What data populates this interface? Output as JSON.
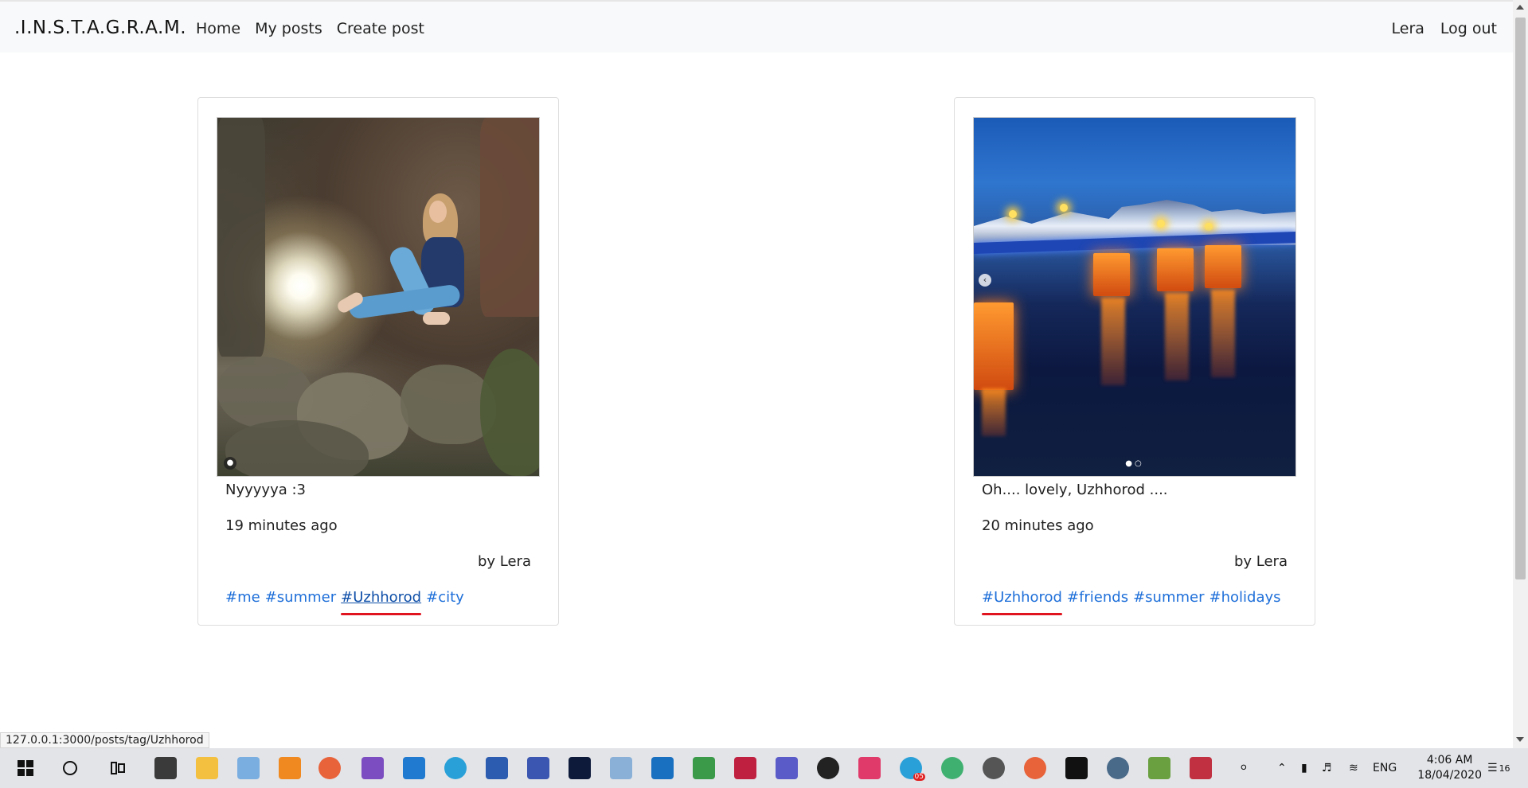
{
  "navbar": {
    "brand": ".I.N.S.T.A.G.R.A.M.",
    "links": [
      "Home",
      "My posts",
      "Create post"
    ],
    "user": "Lera",
    "logout": "Log out"
  },
  "posts": [
    {
      "caption": "Nyyyyya :3",
      "time": "19 minutes ago",
      "author": "by Lera",
      "tags": [
        "#me",
        "#summer",
        "#Uzhhorod",
        "#city"
      ]
    },
    {
      "caption": "Oh.... lovely, Uzhhorod ....",
      "time": "20 minutes ago",
      "author": "by Lera",
      "tags": [
        "#Uzhhorod",
        "#friends",
        "#summer",
        "#holidays"
      ]
    }
  ],
  "status_url": "127.0.0.1:3000/posts/tag/Uzhhorod",
  "taskbar": {
    "language": "ENG",
    "time": "4:06 AM",
    "date": "18/04/2020",
    "notification_count": "16",
    "telegram_badge": "05",
    "icons": [
      "windows-start-icon",
      "search-circle-icon",
      "task-view-icon",
      "calculator-icon",
      "file-explorer-icon",
      "notepad-icon",
      "vlc-icon",
      "firefox-icon",
      "visual-studio-icon",
      "vscode-icon",
      "telegram-icon",
      "word-icon",
      "visio-icon",
      "photoshop-icon",
      "paint-icon",
      "shark-icon",
      "excel-icon",
      "rubymine-icon",
      "teams-icon",
      "github-icon",
      "slack-icon",
      "telegram-icon",
      "atom-icon",
      "settings-icon",
      "firefox-icon",
      "terminal-icon",
      "settings-gear-icon",
      "pen-icon",
      "video-icon"
    ]
  }
}
